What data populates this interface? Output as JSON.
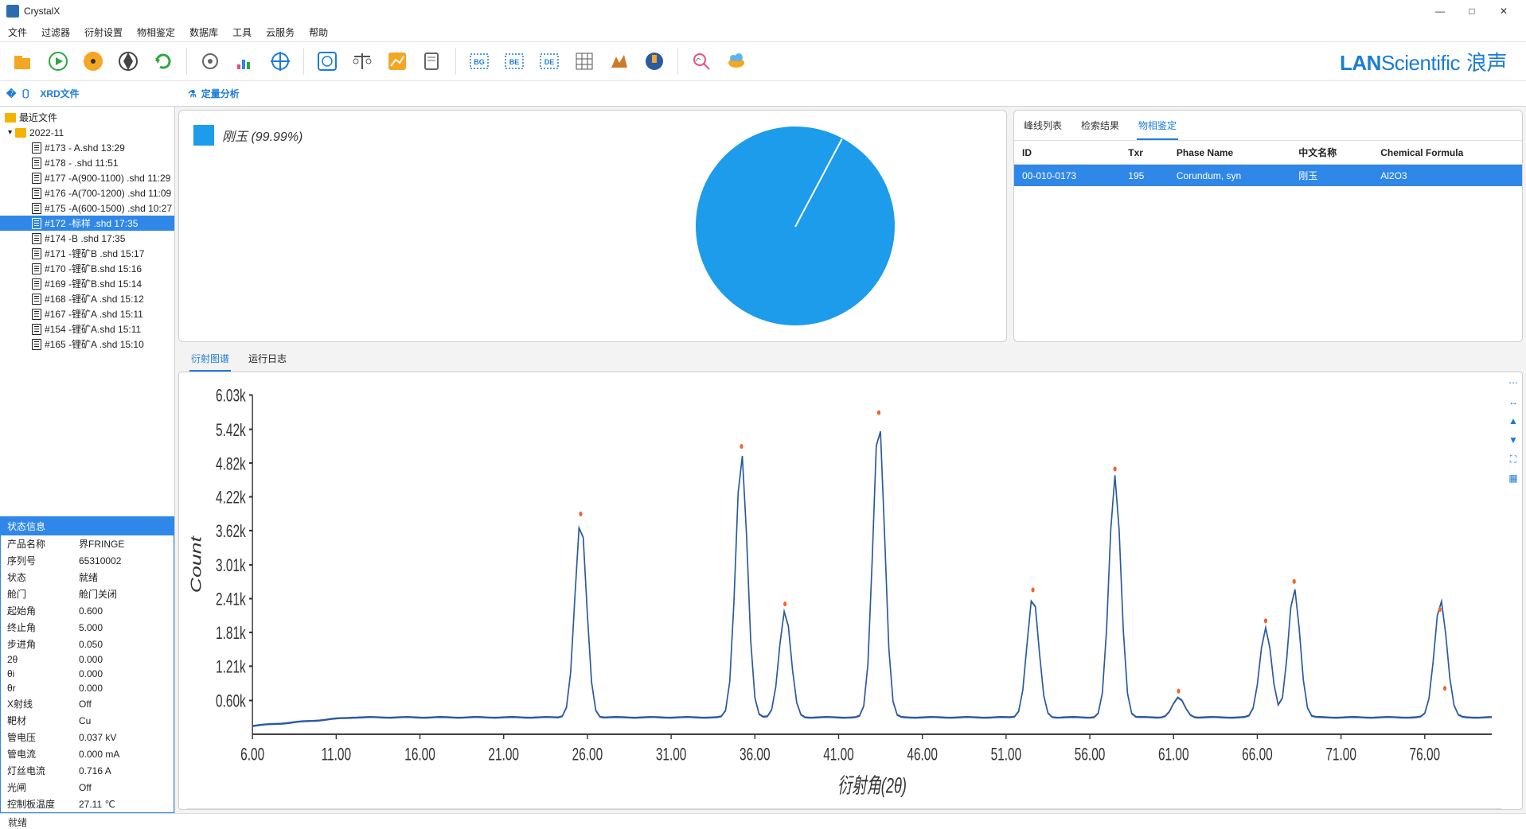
{
  "app_title": "CrystalX",
  "window_buttons": {
    "min": "—",
    "max": "□",
    "close": "✕"
  },
  "menu": [
    "文件",
    "过滤器",
    "衍射设置",
    "物相鉴定",
    "数据库",
    "工具",
    "云服务",
    "帮助"
  ],
  "brand": {
    "a": "LAN",
    "b": "Scientific",
    "cn": "浪声"
  },
  "panel_titles": {
    "left": "XRD文件",
    "right": "定量分析"
  },
  "file_tree": {
    "root": "最近文件",
    "folder": "2022-11",
    "files": [
      "#173 - A.shd 13:29",
      "#178 - .shd 11:51",
      "#177 -A(900-1100) .shd 11:29",
      "#176 -A(700-1200) .shd 11:09",
      "#175 -A(600-1500) .shd 10:27",
      "#172 -标样 .shd 17:35",
      "#174 -B .shd 17:35",
      "#171 -锂矿B .shd 15:17",
      "#170 -锂矿B.shd 15:16",
      "#169 -锂矿B.shd 15:14",
      "#168 -锂矿A .shd 15:12",
      "#167 -锂矿A .shd 15:11",
      "#154 -锂矿A.shd 15:11",
      "#165 -锂矿A .shd 15:10"
    ],
    "selected_index": 5
  },
  "status_panel": {
    "title": "状态信息",
    "rows": [
      [
        "产品名称",
        "界FRINGE"
      ],
      [
        "序列号",
        "65310002"
      ],
      [
        "状态",
        "就绪"
      ],
      [
        "舱门",
        "舱门关闭"
      ],
      [
        "起始角",
        "0.600"
      ],
      [
        "终止角",
        "5.000"
      ],
      [
        "步进角",
        "0.050"
      ],
      [
        "2θ",
        "0.000"
      ],
      [
        "θi",
        "0.000"
      ],
      [
        "θr",
        "0.000"
      ],
      [
        "X射线",
        "Off"
      ],
      [
        "靶材",
        "Cu"
      ],
      [
        "管电压",
        "0.037 kV"
      ],
      [
        "管电流",
        "0.000 mA"
      ],
      [
        "灯丝电流",
        "0.716 A"
      ],
      [
        "光闸",
        "Off"
      ],
      [
        "控制板温度",
        "27.11 ℃"
      ]
    ]
  },
  "pie": {
    "label": "刚玉 (99.99%)"
  },
  "phase_tabs": [
    "峰线列表",
    "检索结果",
    "物相鉴定"
  ],
  "phase_tabs_active": 2,
  "phase_table": {
    "headers": [
      "ID",
      "Txr",
      "Phase Name",
      "中文名称",
      "Chemical Formula"
    ],
    "row": [
      "00-010-0173",
      "195",
      "Corundum, syn",
      "刚玉",
      "Al2O3"
    ]
  },
  "bottom_tabs": [
    "衍射图谱",
    "运行日志"
  ],
  "bottom_tabs_active": 0,
  "status_bar": "就绪",
  "chart_data": {
    "type": "line",
    "title": "",
    "xlabel": "衍射角(2θ)",
    "ylabel": "Count",
    "xlim": [
      6,
      80
    ],
    "ylim": [
      0,
      6030
    ],
    "xticks": [
      6,
      11,
      16,
      21,
      26,
      31,
      36,
      41,
      46,
      51,
      56,
      61,
      66,
      71,
      76
    ],
    "yticks": [
      600,
      1210,
      1810,
      2410,
      3010,
      3620,
      4220,
      4820,
      5420,
      6030
    ],
    "yticklabels": [
      "0.60k",
      "1.21k",
      "1.81k",
      "2.41k",
      "3.01k",
      "3.62k",
      "4.22k",
      "4.82k",
      "5.42k",
      "6.03k"
    ],
    "baseline": 300,
    "peaks": [
      {
        "x": 25.6,
        "y": 3800
      },
      {
        "x": 35.2,
        "y": 5000
      },
      {
        "x": 37.8,
        "y": 2200
      },
      {
        "x": 43.4,
        "y": 5600
      },
      {
        "x": 52.6,
        "y": 2450
      },
      {
        "x": 57.5,
        "y": 4600
      },
      {
        "x": 61.3,
        "y": 650
      },
      {
        "x": 66.5,
        "y": 1900
      },
      {
        "x": 68.2,
        "y": 2600
      },
      {
        "x": 76.9,
        "y": 2100
      },
      {
        "x": 77.2,
        "y": 700
      }
    ]
  }
}
